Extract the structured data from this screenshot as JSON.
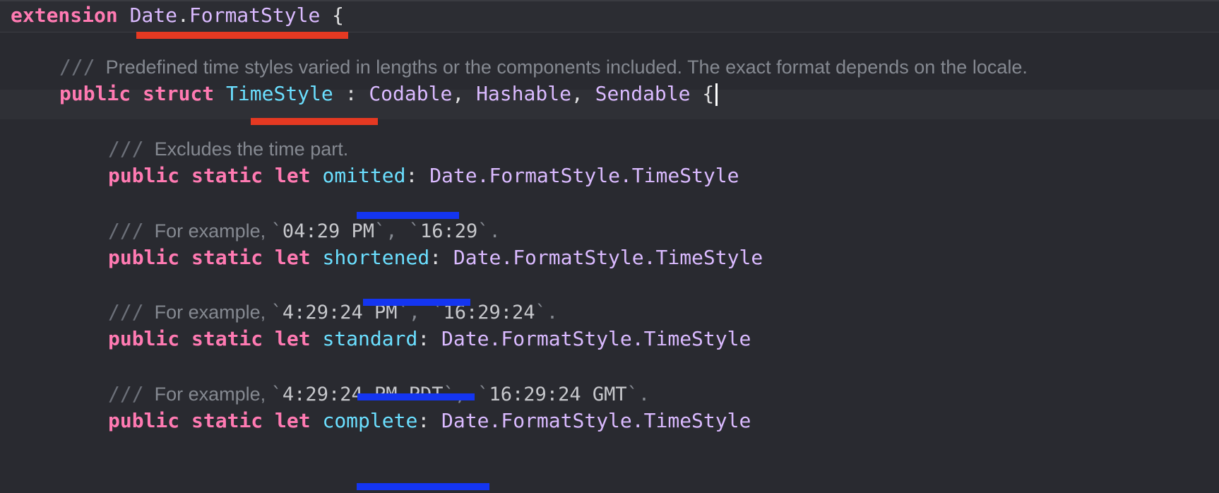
{
  "code": {
    "ext_kw": "extension",
    "ext_type_a": "Date",
    "dot": ".",
    "ext_type_b": "FormatStyle",
    "brace_open": " {",
    "doc_struct": "Predefined time styles varied in lengths or the components included. The exact format depends on the locale.",
    "kw_public": "public",
    "kw_struct": "struct",
    "struct_name": "TimeStyle",
    "conformance_sep": " : ",
    "proto1": "Codable",
    "proto2": "Hashable",
    "proto3": "Sendable",
    "comma": ", ",
    "kw_static": "static",
    "kw_let": "let",
    "colon": ": ",
    "type_path": "Date.FormatStyle.TimeStyle",
    "doc_slashes": "///",
    "members": [
      {
        "doc_text": "Excludes the time part.",
        "name": "omitted"
      },
      {
        "doc_prefix": "For example, ",
        "ex1": "04:29 PM",
        "ex2": "16:29",
        "name": "shortened"
      },
      {
        "doc_prefix": "For example, ",
        "ex1": "4:29:24 PM",
        "ex2": "16:29:24",
        "name": "standard"
      },
      {
        "doc_prefix": "For example, ",
        "ex1": "4:29:24 PM PDT",
        "ex2": "16:29:24 GMT",
        "name": "complete"
      }
    ]
  },
  "colors": {
    "background": "#292a30",
    "keyword": "#ff7ab2",
    "type": "#dabaff",
    "declaration": "#6bdfff",
    "comment": "#858991",
    "underline_red": "#e53922",
    "underline_blue": "#1435f0"
  }
}
